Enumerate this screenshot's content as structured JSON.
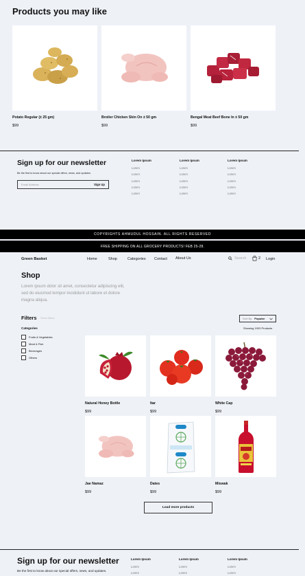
{
  "recommend": {
    "title": "Products you may like",
    "products": [
      {
        "name": "Potato Regular (± 25 gm)",
        "price": "$99",
        "image": "potatoes"
      },
      {
        "name": "Broiler Chicken Skin On ± 50 gm",
        "price": "$99",
        "image": "raw-chicken"
      },
      {
        "name": "Bengal Meat Beef Bone In ± 50 gm",
        "price": "$99",
        "image": "beef-cubes"
      }
    ]
  },
  "newsletter": {
    "title": "Sign up for our newsletter",
    "subtitle": "Be the first to know about our special offers, news, and updates.",
    "email_placeholder": "Email Address",
    "signup_label": "Sign Up"
  },
  "footer": {
    "columns": [
      {
        "heading": "Lorem Ipsum",
        "links": [
          "Lorem",
          "Lorem",
          "Lorem",
          "Lorem",
          "Lorem"
        ]
      },
      {
        "heading": "Lorem Ipsum",
        "links": [
          "Lorem",
          "Lorem",
          "Lorem",
          "Lorem",
          "Lorem"
        ]
      },
      {
        "heading": "Lorem Ipsum",
        "links": [
          "Lorem",
          "Lorem",
          "Lorem",
          "Lorem",
          "Lorem"
        ]
      }
    ]
  },
  "copyright": "COPYRIGHTS AHMUDUL HOSSAIN. ALL RIGHTS RESERVED",
  "promo": "FREE SHIPPING ON ALL GROCERY PRODUCTS! FEB 25-28.",
  "nav": {
    "brand": "Green Basket",
    "links": [
      "Home",
      "Shop",
      "Categories",
      "Contact",
      "About Us"
    ],
    "search_placeholder": "Search",
    "cart_count": "2",
    "login": "Login"
  },
  "shop": {
    "title": "Shop",
    "description": "Lorem ipsum dolor sit amet, consectetur adipiscing elit, sed do eiusmod tempor incididunt ut labore et dolore magna aliqua.",
    "filters_label": "Filters",
    "show_filters": "Show filters",
    "sort_label": "Sort By:",
    "sort_value": "Popular",
    "showing": "Showing 1903 Products",
    "categories_title": "Categories",
    "categories": [
      "Fruits & Vegetables",
      "Meat & Fish",
      "Beverages",
      "Others"
    ],
    "products": [
      {
        "name": "Natural Honey Bottle",
        "price": "$99",
        "image": "pomegranate"
      },
      {
        "name": "Itar",
        "price": "$99",
        "image": "tomatoes"
      },
      {
        "name": "White Cap",
        "price": "$99",
        "image": "grapes"
      },
      {
        "name": "Jae Namaz",
        "price": "$99",
        "image": "raw-chicken"
      },
      {
        "name": "Dates",
        "price": "$99",
        "image": "milk-pouch"
      },
      {
        "name": "Miswak",
        "price": "$99",
        "image": "sauce-bottle"
      }
    ],
    "load_more": "Load more products"
  },
  "colors": {
    "background": "#eef1f6",
    "bar": "#000000",
    "text": "#111111",
    "muted": "#999999"
  }
}
